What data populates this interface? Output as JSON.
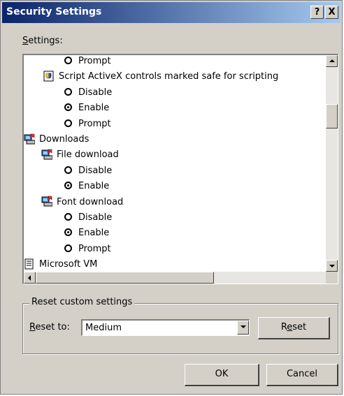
{
  "window": {
    "title": "Security Settings",
    "help_label": "?",
    "close_label": "X"
  },
  "settings_label_prefix": "S",
  "settings_label_rest": "ettings:",
  "tree": [
    {
      "type": "radio",
      "label": "Prompt",
      "checked": false,
      "level": 3
    },
    {
      "type": "item",
      "icon": "script-shield-icon",
      "label": "Script ActiveX controls marked safe for scripting",
      "level": 2
    },
    {
      "type": "radio",
      "label": "Disable",
      "checked": false,
      "level": 3
    },
    {
      "type": "radio",
      "label": "Enable",
      "checked": true,
      "level": 3
    },
    {
      "type": "radio",
      "label": "Prompt",
      "checked": false,
      "level": 3
    },
    {
      "type": "item",
      "icon": "download-icon",
      "label": "Downloads",
      "level": 0
    },
    {
      "type": "item",
      "icon": "download-icon",
      "label": "File download",
      "level": 1
    },
    {
      "type": "radio",
      "label": "Disable",
      "checked": false,
      "level": 3
    },
    {
      "type": "radio",
      "label": "Enable",
      "checked": true,
      "level": 3
    },
    {
      "type": "item",
      "icon": "download-icon",
      "label": "Font download",
      "level": 1
    },
    {
      "type": "radio",
      "label": "Disable",
      "checked": false,
      "level": 3
    },
    {
      "type": "radio",
      "label": "Enable",
      "checked": true,
      "level": 3
    },
    {
      "type": "radio",
      "label": "Prompt",
      "checked": false,
      "level": 3
    },
    {
      "type": "item",
      "icon": "document-icon",
      "label": "Microsoft VM",
      "level": 0
    }
  ],
  "reset_group": {
    "title": "Reset custom settings",
    "reset_to_prefix": "R",
    "reset_to_rest": "eset to:",
    "selected": "Medium",
    "reset_button_pre": "R",
    "reset_button_u": "e",
    "reset_button_post": "set"
  },
  "buttons": {
    "ok": "OK",
    "cancel": "Cancel"
  },
  "colors": {
    "face": "#d4d0c8",
    "title_start": "#0a246a",
    "title_end": "#a6caf0"
  }
}
